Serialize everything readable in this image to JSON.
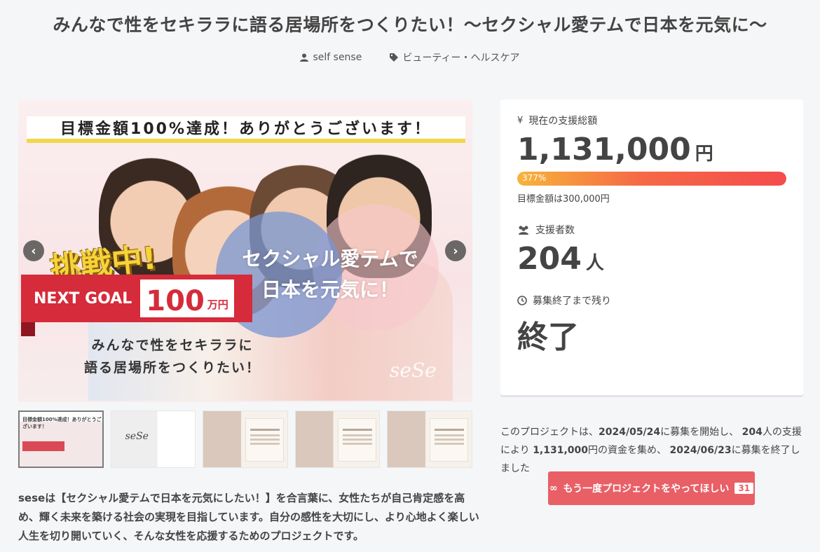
{
  "page": {
    "title": "みんなで性をセキララに語る居場所をつくりたい！〜セクシャル愛テムで日本を元気に〜",
    "author": "self sense",
    "category": "ビューティー・ヘルスケア"
  },
  "hero": {
    "banner_top": "目標金額100%達成！ありがとうございます！",
    "challenge": "挑戦中!",
    "main_text_line1": "セクシャル愛テムで",
    "main_text_line2": "日本を元気に！",
    "next_goal_label": "NEXT GOAL",
    "next_goal_amount": "100",
    "next_goal_unit": "万円",
    "sub_line1": "みんなで性をセキララに",
    "sub_line2": "語る居場所をつくりたい！",
    "logo": "seSe",
    "prev_symbol": "‹",
    "next_symbol": "›"
  },
  "thumbnails": [
    {
      "active": true
    },
    {
      "active": false,
      "logo": "seSe"
    },
    {
      "active": false
    },
    {
      "active": false
    },
    {
      "active": false
    }
  ],
  "description": "seseは【セクシャル愛テムで日本を元気にしたい！】を合言葉に、女性たちが自己肯定感を高め、輝く未来を築ける社会の実現を目指しています。自分の感性を大切にし、より心地よく楽しい人生を切り開いていく、そんな女性を応援するためのプロジェクトです。",
  "stats": {
    "total_label": "現在の支援総額",
    "total_value": "1,131,000",
    "total_unit": "円",
    "progress_label": "377%",
    "progress_fraction": 1.0,
    "goal_text": "目標金額は300,000円",
    "backers_label": "支援者数",
    "backers_value": "204",
    "backers_unit": "人",
    "remaining_label": "募集終了まで残り",
    "remaining_value": "終了"
  },
  "summary": {
    "part1": "このプロジェクトは、",
    "start_date": "2024/05/24",
    "part2": "に募集を開始し、",
    "backers": "204",
    "part3": "人の支援により",
    "amount": "1,131,000",
    "part4": "円の資金を集め、",
    "end_date": "2024/06/23",
    "part5": "に募集を終了しました"
  },
  "cta": {
    "icon": "∞",
    "label": "もう一度プロジェクトをやってほしい",
    "count": "31"
  },
  "colors": {
    "accent": "#e95f66",
    "progress_start": "#f7b43a",
    "progress_end": "#f44c4c",
    "background": "#f5f6f8"
  }
}
